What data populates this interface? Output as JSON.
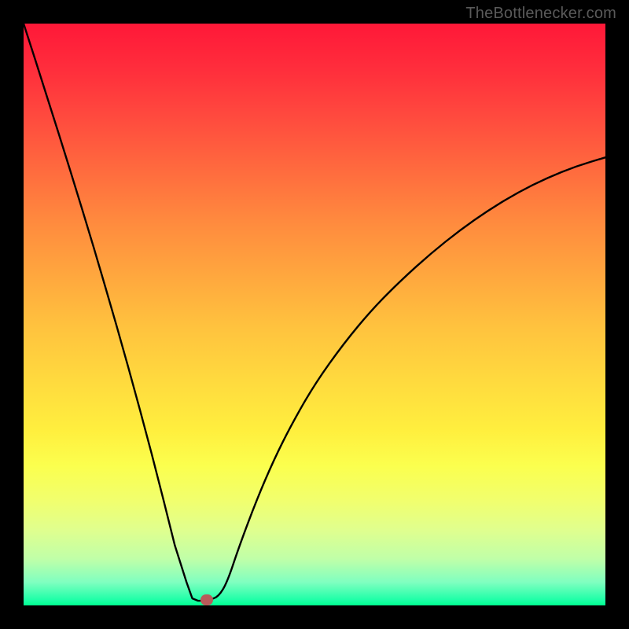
{
  "watermark": "TheBottlenecker.com",
  "colors": {
    "curve_stroke": "#000000",
    "marker_fill": "#b85a5a",
    "frame_bg": "#000000"
  },
  "chart_data": {
    "type": "line",
    "title": "",
    "xlabel": "",
    "ylabel": "",
    "xlim": [
      0,
      1
    ],
    "ylim": [
      0,
      1
    ],
    "x": [
      0.0,
      0.02,
      0.04,
      0.06,
      0.08,
      0.1,
      0.12,
      0.14,
      0.16,
      0.18,
      0.2,
      0.22,
      0.24,
      0.26,
      0.28,
      0.29,
      0.3,
      0.31,
      0.32,
      0.335,
      0.35,
      0.37,
      0.4,
      0.43,
      0.46,
      0.5,
      0.55,
      0.6,
      0.65,
      0.7,
      0.75,
      0.8,
      0.85,
      0.9,
      0.95,
      1.0
    ],
    "values": [
      1.0,
      0.938,
      0.875,
      0.812,
      0.748,
      0.683,
      0.617,
      0.549,
      0.48,
      0.409,
      0.336,
      0.261,
      0.183,
      0.103,
      0.04,
      0.012,
      0.008,
      0.008,
      0.01,
      0.015,
      0.04,
      0.1,
      0.18,
      0.25,
      0.31,
      0.38,
      0.45,
      0.51,
      0.56,
      0.605,
      0.645,
      0.68,
      0.71,
      0.735,
      0.755,
      0.77
    ],
    "marker": {
      "x": 0.315,
      "y": 0.009
    },
    "notch_segment": {
      "x0": 0.29,
      "y0": 0.012,
      "x1": 0.31,
      "y1": 0.008
    }
  }
}
